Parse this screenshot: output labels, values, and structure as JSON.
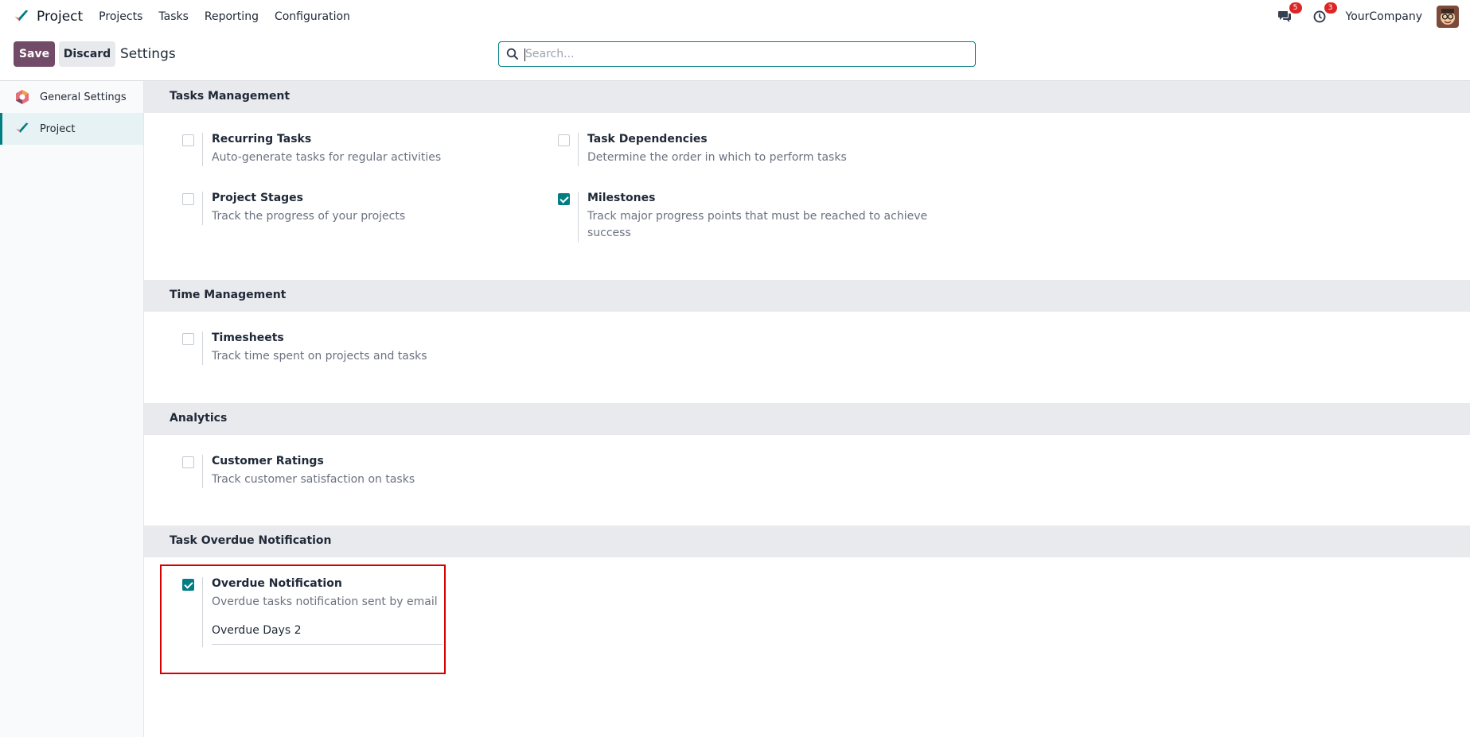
{
  "navbar": {
    "app_name": "Project",
    "menu": [
      "Projects",
      "Tasks",
      "Reporting",
      "Configuration"
    ],
    "messages_badge": "5",
    "activities_badge": "3",
    "company": "YourCompany"
  },
  "control_panel": {
    "save_label": "Save",
    "discard_label": "Discard",
    "title": "Settings",
    "search_placeholder": "Search...",
    "search_value": ""
  },
  "sidebar": {
    "items": [
      {
        "label": "General Settings",
        "icon": "odoo-settings-icon",
        "active": false
      },
      {
        "label": "Project",
        "icon": "project-app-icon",
        "active": true
      }
    ]
  },
  "sections": {
    "tasks_management": {
      "title": "Tasks Management",
      "settings": [
        {
          "title": "Recurring Tasks",
          "desc": "Auto-generate tasks for regular activities",
          "checked": false
        },
        {
          "title": "Task Dependencies",
          "desc": "Determine the order in which to perform tasks",
          "checked": false
        },
        {
          "title": "Project Stages",
          "desc": "Track the progress of your projects",
          "checked": false
        },
        {
          "title": "Milestones",
          "desc_line1": "Track major progress points that must be reached to achieve",
          "desc_line2": "success",
          "checked": true
        }
      ]
    },
    "time_management": {
      "title": "Time Management",
      "settings": [
        {
          "title": "Timesheets",
          "desc": "Track time spent on projects and tasks",
          "checked": false
        }
      ]
    },
    "analytics": {
      "title": "Analytics",
      "settings": [
        {
          "title": "Customer Ratings",
          "desc": "Track customer satisfaction on tasks",
          "checked": false
        }
      ]
    },
    "task_overdue": {
      "title": "Task Overdue Notification",
      "settings": [
        {
          "title": "Overdue Notification",
          "desc": "Overdue tasks notification sent by email",
          "checked": true,
          "field_label": "Overdue Days",
          "field_value": "2"
        }
      ]
    }
  },
  "colors": {
    "primary": "#714b67",
    "accent": "#017e84",
    "highlight_border": "#d60000"
  }
}
